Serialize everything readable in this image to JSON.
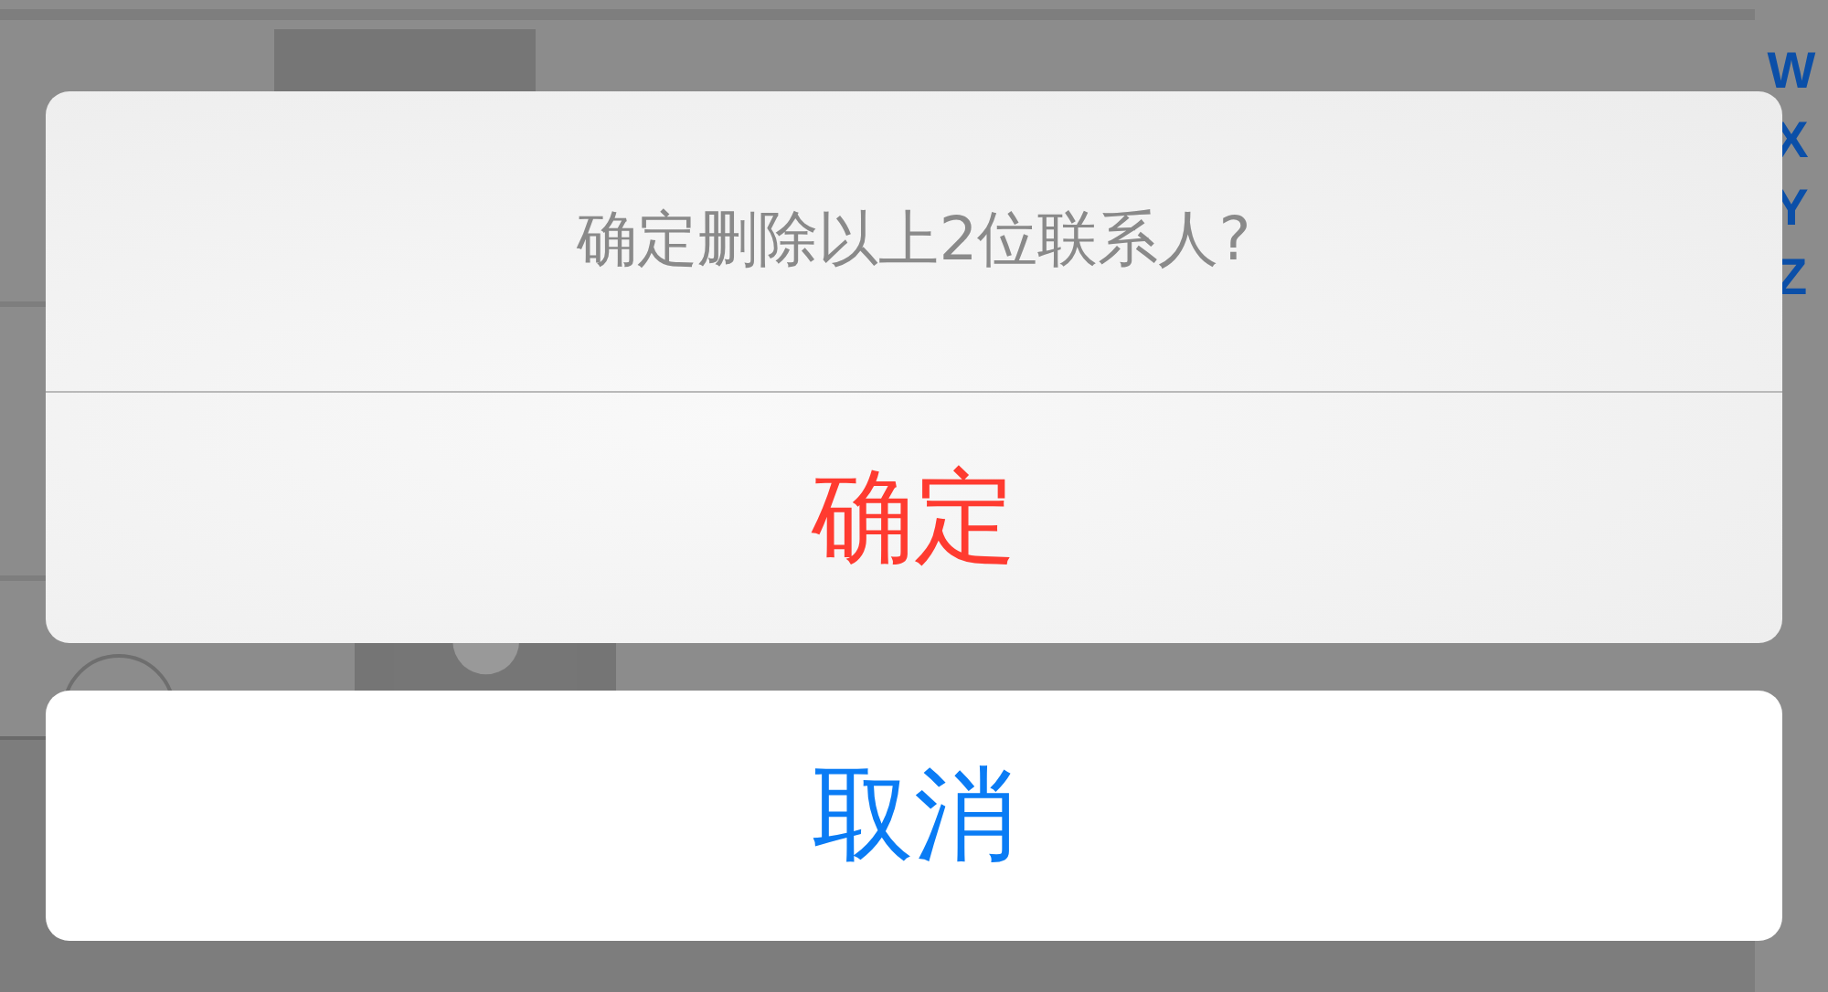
{
  "contacts_index": [
    {
      "label": "W"
    },
    {
      "label": "X"
    },
    {
      "label": "Y"
    },
    {
      "label": "Z"
    }
  ],
  "action_sheet": {
    "message": "确定删除以上2位联系人?",
    "actions": [
      {
        "label": "确定",
        "kind": "destructive"
      }
    ],
    "cancel": {
      "label": "取消"
    }
  }
}
